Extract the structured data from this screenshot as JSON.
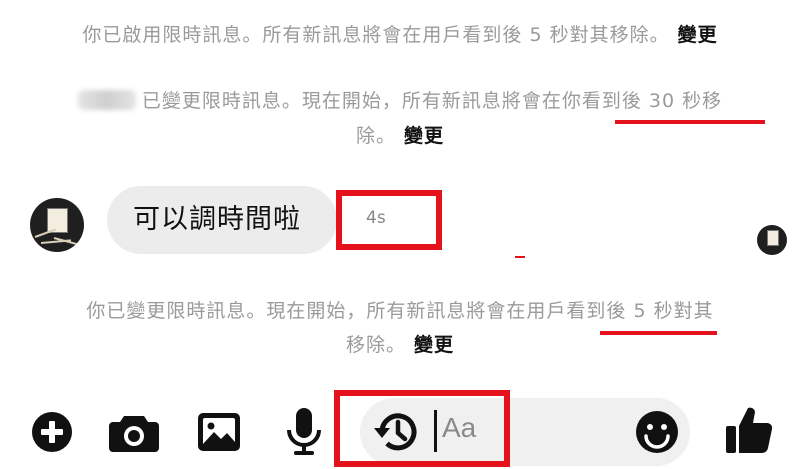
{
  "notices": {
    "line1": "你已啟用限時訊息。所有新訊息將會在用戶看到後 5 秒對其移除。",
    "line2a": "已變更限時訊息。現在開始，所有新訊息將會在你看到後 30 秒移",
    "line2b": "除。",
    "line3a": "你已變更限時訊息。現在開始，所有新訊息將會在用戶看到後 5 秒對其",
    "line3b": "移除。",
    "change_label": "變更"
  },
  "message": {
    "text": "可以調時間啦",
    "timer": "4s"
  },
  "composer": {
    "placeholder": "Aa"
  },
  "icons": {
    "add": "plus-circle-icon",
    "camera": "camera-icon",
    "gallery": "image-icon",
    "voice": "microphone-icon",
    "timer": "history-clock-icon",
    "emoji": "smiley-icon",
    "like": "thumbs-up-icon"
  },
  "colors": {
    "annotation_red": "#e5121b",
    "system_text": "#9a9a9a",
    "bubble_bg": "#ececec"
  }
}
